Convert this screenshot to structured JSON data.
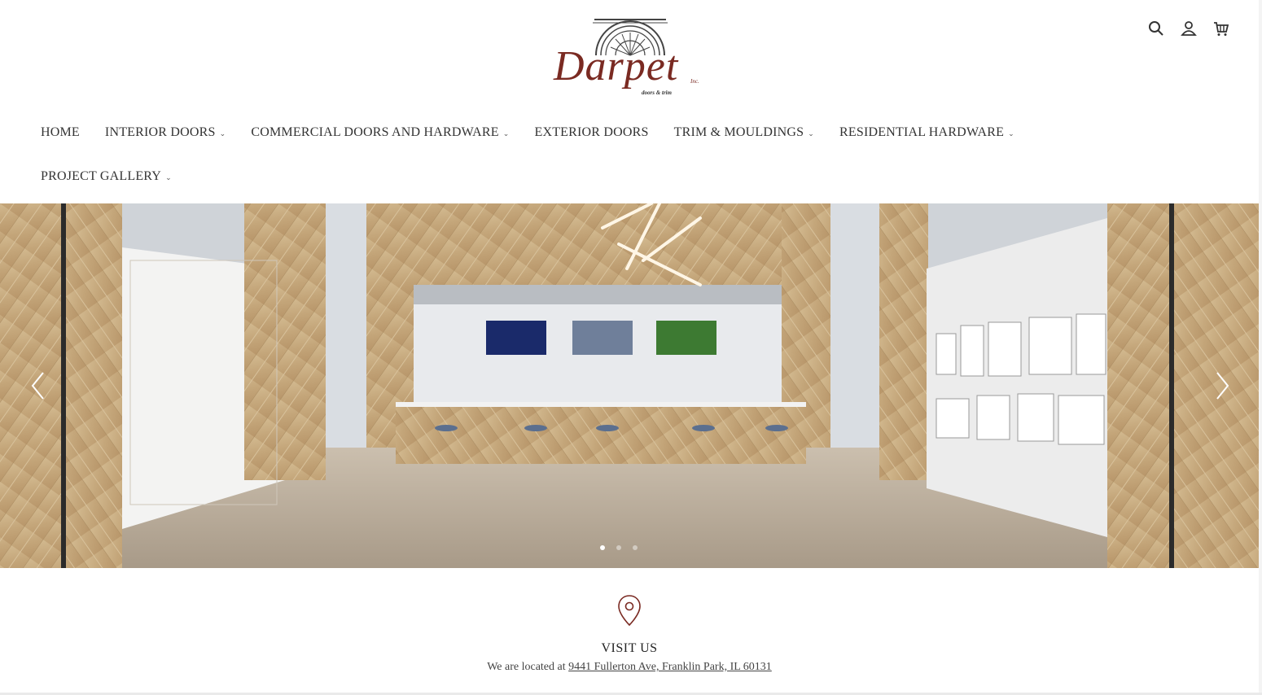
{
  "brand": {
    "name": "Darpet",
    "inc": "Inc.",
    "tagline": "doors & trim",
    "color": "#7a2a22"
  },
  "header_icons": [
    {
      "name": "search-icon"
    },
    {
      "name": "account-icon"
    },
    {
      "name": "cart-icon"
    }
  ],
  "nav": {
    "home": "HOME",
    "interior_doors": "INTERIOR DOORS",
    "commercial": "COMMERCIAL DOORS AND HARDWARE",
    "exterior": "EXTERIOR DOORS",
    "trim": "TRIM & MOULDINGS",
    "residential": "RESIDENTIAL HARDWARE",
    "gallery": "PROJECT GALLERY"
  },
  "slider": {
    "active_slide": 1,
    "slide_count": 3,
    "prev_icon": "chevron-left-icon",
    "next_icon": "chevron-right-icon"
  },
  "visit": {
    "icon": "map-pin-icon",
    "title": "VISIT US",
    "prefix": "We are located at",
    "address": "9441 Fullerton Ave, Franklin Park, IL 60131"
  }
}
